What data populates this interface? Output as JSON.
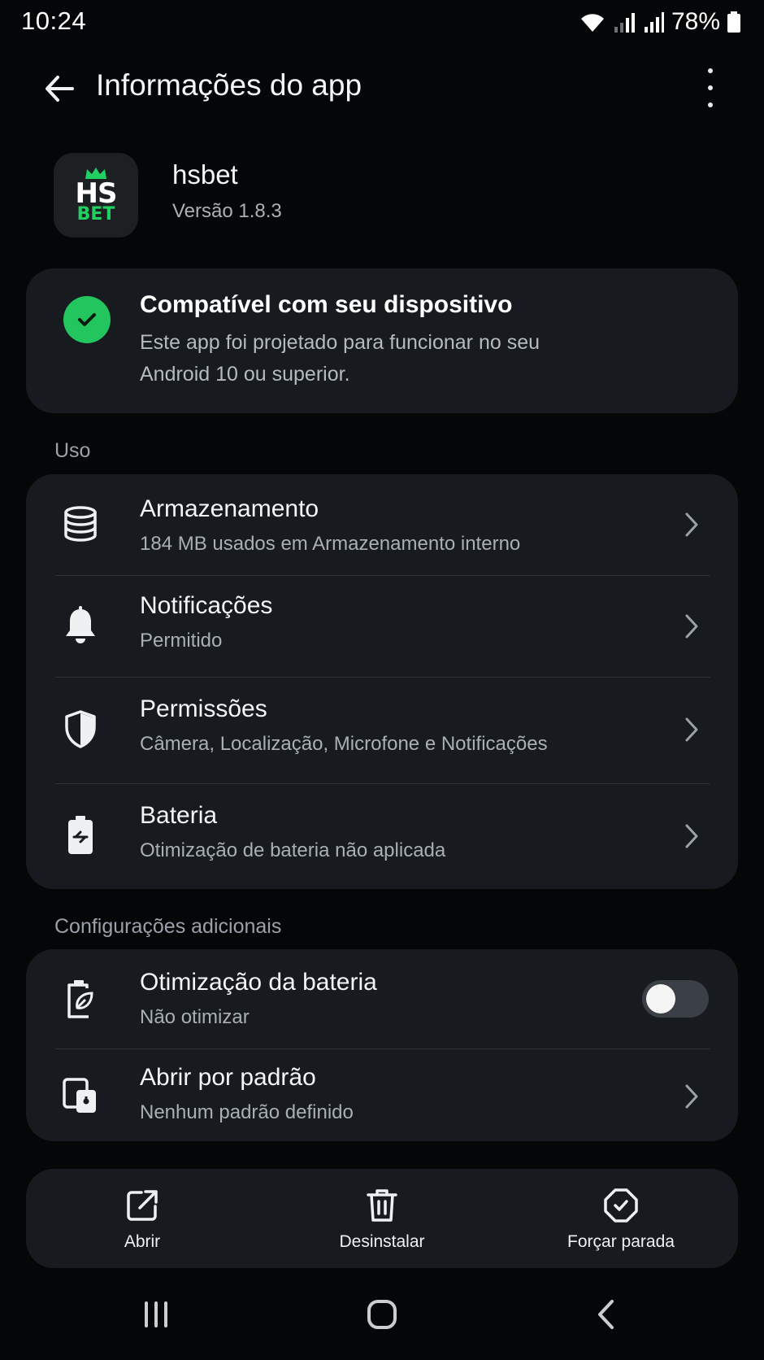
{
  "status_bar": {
    "time": "10:24",
    "battery_percent": "78%",
    "icons": [
      "wifi-icon",
      "signal-icon",
      "signal-icon",
      "battery-icon"
    ]
  },
  "top_bar": {
    "title": "Informações do app",
    "back_icon": "arrow-left-icon",
    "more_icon": "more-vertical-icon"
  },
  "app": {
    "name": "hsbet",
    "version": "Versão 1.8.3",
    "logo_text_top": "HS",
    "logo_text_bottom": "BET",
    "logo_accent": "#21d060"
  },
  "compatibility": {
    "title": "Compatível com seu dispositivo",
    "description": "Este app foi projetado para funcionar no seu Android 10 ou superior.",
    "accent": "#22c55e"
  },
  "usage": {
    "label": "Uso",
    "items": [
      {
        "icon": "database-icon",
        "title": "Armazenamento",
        "subtitle": "184 MB usados em Armazenamento interno"
      },
      {
        "icon": "bell-icon",
        "title": "Notificações",
        "subtitle": "Permitido"
      },
      {
        "icon": "shield-icon",
        "title": "Permissões",
        "subtitle": "Câmera, Localização, Microfone e Notificações"
      },
      {
        "icon": "battery-icon",
        "title": "Bateria",
        "subtitle": "Otimização de bateria não aplicada"
      }
    ]
  },
  "additional": {
    "label": "Configurações adicionais",
    "items": [
      {
        "icon": "battery-optimization-icon",
        "title": "Otimização da bateria",
        "subtitle": "Não otimizar",
        "toggle_on": false
      },
      {
        "icon": "open-by-default-icon",
        "title": "Abrir por padrão",
        "subtitle": "Nenhum padrão definido"
      }
    ]
  },
  "actions": [
    {
      "icon": "external-link-icon",
      "label": "Abrir"
    },
    {
      "icon": "trash-icon",
      "label": "Desinstalar"
    },
    {
      "icon": "stop-icon",
      "label": "Forçar parada"
    }
  ],
  "nav_bar": {
    "icons": [
      "recents-icon",
      "home-icon",
      "back-icon"
    ]
  }
}
